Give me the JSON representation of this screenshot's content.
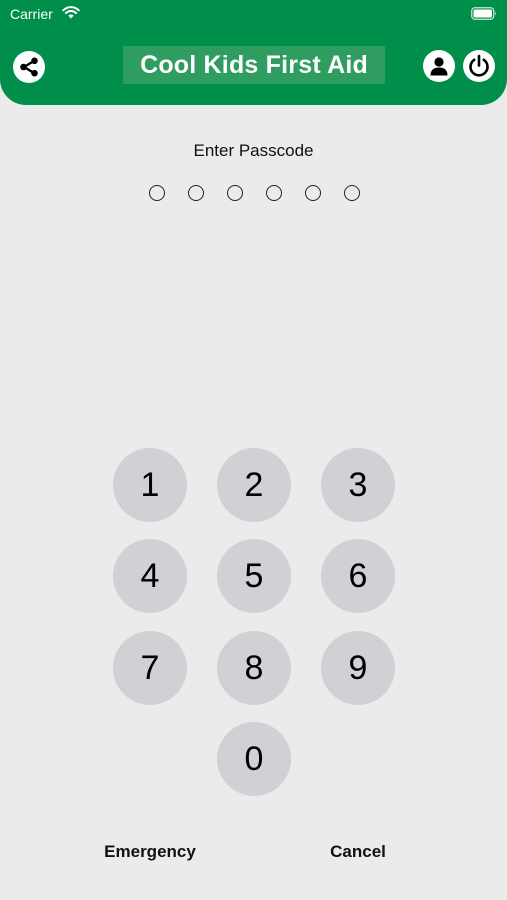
{
  "status_bar": {
    "carrier": "Carrier"
  },
  "header": {
    "title": "Cool Kids First Aid",
    "background_color": "#008f4a",
    "title_box_color": "#2f9d60",
    "left_icon": "share-icon",
    "right_icons": [
      "profile-icon",
      "power-icon"
    ]
  },
  "passcode": {
    "prompt": "Enter Passcode",
    "length": 6,
    "entered": 0
  },
  "keypad": {
    "keys": [
      "1",
      "2",
      "3",
      "4",
      "5",
      "6",
      "7",
      "8",
      "9",
      "0"
    ],
    "key_color": "#d0d0d5"
  },
  "actions": {
    "emergency": "Emergency",
    "cancel": "Cancel"
  }
}
